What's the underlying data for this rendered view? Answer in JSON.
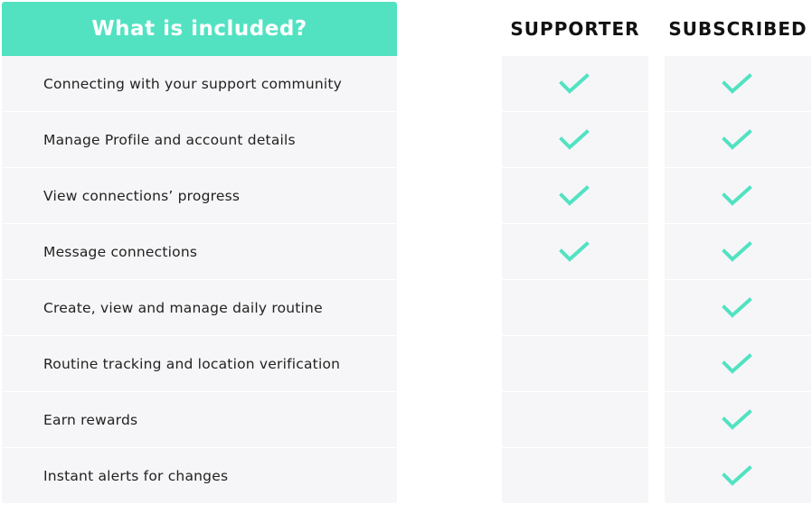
{
  "header": {
    "title": "What is included?",
    "columns": [
      "SUPPORTER",
      "SUBSCRIBED"
    ]
  },
  "colors": {
    "accent": "#52e2c2",
    "row_background": "#f6f6f8",
    "text": "#222222"
  },
  "features": [
    {
      "label": "Connecting with your support community",
      "supporter": true,
      "subscribed": true
    },
    {
      "label": "Manage Profile and account details",
      "supporter": true,
      "subscribed": true
    },
    {
      "label": "View connections’ progress",
      "supporter": true,
      "subscribed": true
    },
    {
      "label": "Message connections",
      "supporter": true,
      "subscribed": true
    },
    {
      "label": "Create, view and manage daily routine",
      "supporter": false,
      "subscribed": true
    },
    {
      "label": "Routine tracking and location verification",
      "supporter": false,
      "subscribed": true
    },
    {
      "label": "Earn rewards",
      "supporter": false,
      "subscribed": true
    },
    {
      "label": "Instant alerts for changes",
      "supporter": false,
      "subscribed": true
    }
  ]
}
